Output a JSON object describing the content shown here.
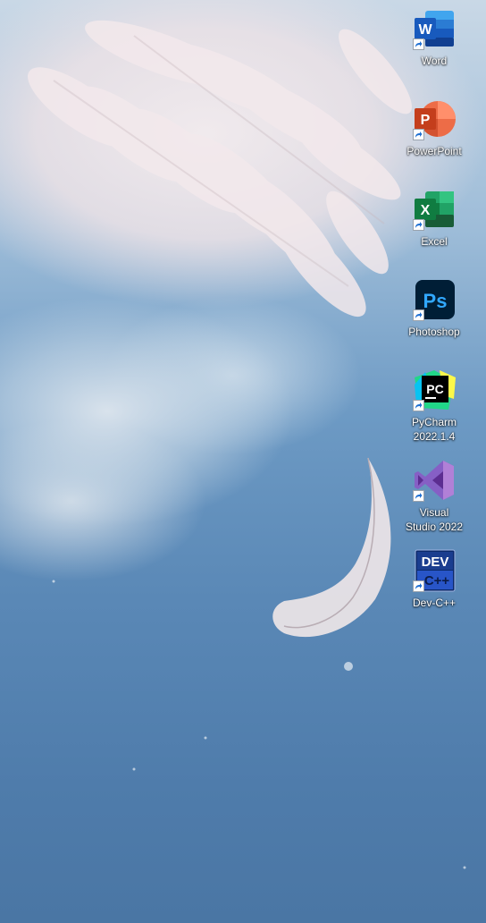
{
  "desktop": {
    "icons": [
      {
        "label": "Word",
        "icon": "word-icon",
        "color": "#185abd"
      },
      {
        "label": "PowerPoint",
        "icon": "powerpoint-icon",
        "color": "#c43e1c"
      },
      {
        "label": "Excel",
        "icon": "excel-icon",
        "color": "#107c41"
      },
      {
        "label": "Photoshop",
        "icon": "photoshop-icon",
        "color": "#31a8ff"
      },
      {
        "label": "PyCharm\n2022.1.4",
        "icon": "pycharm-icon",
        "color": "#21d789"
      },
      {
        "label": "Visual\nStudio 2022",
        "icon": "visual-studio-icon",
        "color": "#865fc5"
      },
      {
        "label": "Dev-C++",
        "icon": "dev-cpp-icon",
        "color": "#1a3d8f"
      }
    ],
    "glyphs": {
      "word": "W",
      "powerpoint": "P",
      "excel": "X",
      "photoshop": "Ps",
      "pycharm": "PC",
      "dev_cpp_top": "DEV",
      "dev_cpp_bottom": "C++"
    }
  }
}
